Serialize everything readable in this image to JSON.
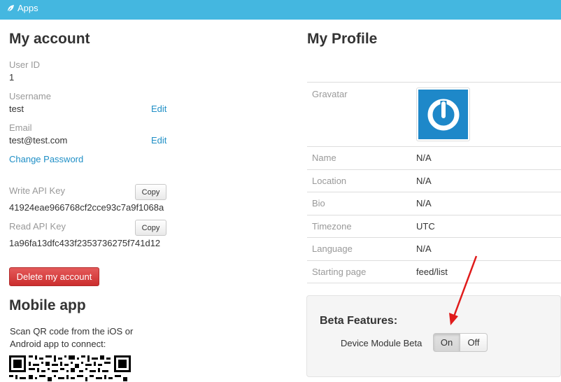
{
  "topbar": {
    "app_label": "Apps",
    "icon": "leaf-icon"
  },
  "account": {
    "title": "My account",
    "user_id_label": "User ID",
    "user_id": "1",
    "username_label": "Username",
    "username": "test",
    "username_edit": "Edit",
    "email_label": "Email",
    "email": "test@test.com",
    "email_edit": "Edit",
    "change_password": "Change Password",
    "write_key_label": "Write API Key",
    "write_key": "41924eae966768cf2cce93c7a9f1068a",
    "read_key_label": "Read API Key",
    "read_key": "1a96fa13dfc433f2353736275f741d12",
    "copy_label": "Copy",
    "delete_label": "Delete my account",
    "colors": {
      "link": "#1f8fc6",
      "danger": "#d13b3b",
      "topbar": "#44b7e0"
    }
  },
  "mobile": {
    "title": "Mobile app",
    "line1": "Scan QR code from the iOS or",
    "line2": "Android app to connect:"
  },
  "profile": {
    "title": "My Profile",
    "gravatar_label": "Gravatar",
    "rows": [
      {
        "label": "Name",
        "value": "N/A"
      },
      {
        "label": "Location",
        "value": "N/A"
      },
      {
        "label": "Bio",
        "value": "N/A"
      },
      {
        "label": "Timezone",
        "value": "UTC"
      },
      {
        "label": "Language",
        "value": "N/A"
      },
      {
        "label": "Starting page",
        "value": "feed/list"
      }
    ]
  },
  "beta": {
    "title": "Beta Features:",
    "device_label": "Device Module Beta",
    "on_label": "On",
    "off_label": "Off",
    "selected": "On"
  }
}
